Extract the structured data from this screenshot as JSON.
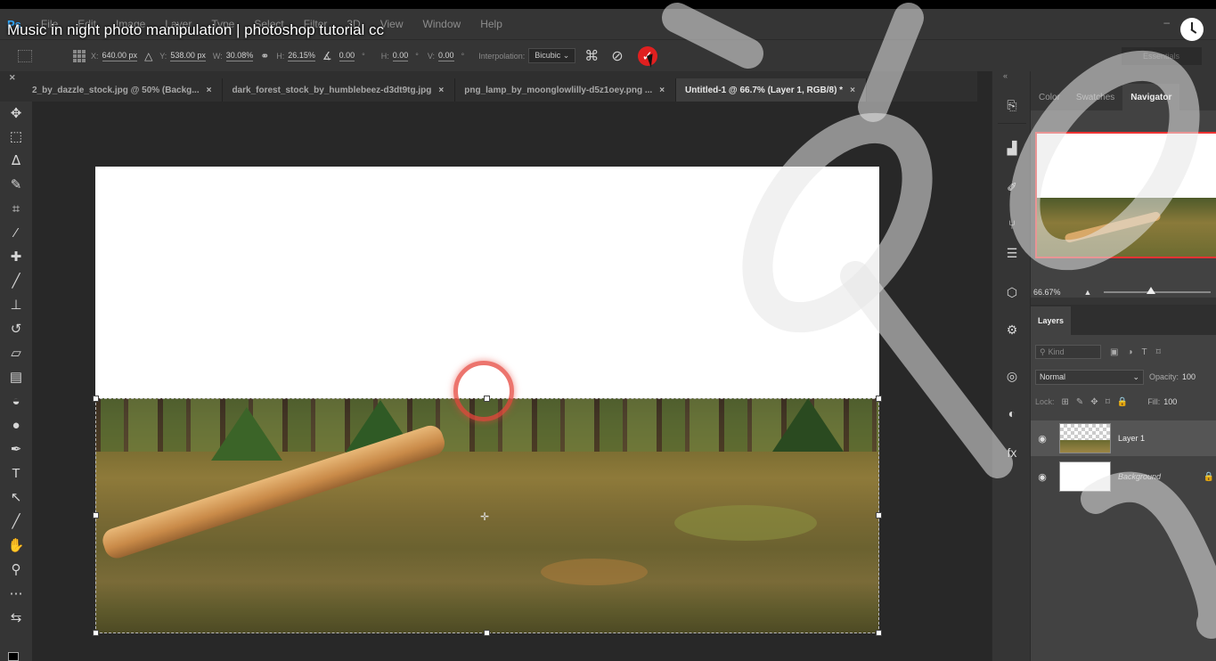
{
  "overlay": {
    "title": "Music in night photo manipulation | photoshop tutorial cc"
  },
  "menubar": {
    "logo": "Ps",
    "items": [
      "File",
      "Edit",
      "Image",
      "Layer",
      "Type",
      "Select",
      "Filter",
      "3D",
      "View",
      "Window",
      "Help"
    ]
  },
  "options": {
    "x_label": "X:",
    "x_value": "640.00 px",
    "y_label": "Y:",
    "y_value": "538.00 px",
    "w_label": "W:",
    "w_value": "30.08%",
    "h_label": "H:",
    "h_value": "26.15%",
    "angle_value": "0.00",
    "deg": "°",
    "hskew_label": "H:",
    "hskew_value": "0.00",
    "vskew_label": "V:",
    "vskew_value": "0.00",
    "interp_label": "Interpolation:",
    "interp_value": "Bicubic",
    "workspace": "Essentials"
  },
  "tabs": [
    {
      "label": "2_by_dazzle_stock.jpg @ 50% (Backg...",
      "close": "×"
    },
    {
      "label": "dark_forest_stock_by_humblebeez-d3dt9tg.jpg",
      "close": "×"
    },
    {
      "label": "png_lamp_by_moonglowlilly-d5z1oey.png ...",
      "close": "×"
    },
    {
      "label": "Untitled-1 @ 66.7% (Layer 1, RGB/8) *",
      "close": "×"
    }
  ],
  "navigator": {
    "tabs": [
      "Color",
      "Swatches",
      "Navigator"
    ],
    "zoom": "66.67%"
  },
  "layers": {
    "tab": "Layers",
    "kind_placeholder": "Kind",
    "blend_mode": "Normal",
    "opacity_label": "Opacity:",
    "opacity_value": "100",
    "lock_label": "Lock:",
    "fill_label": "Fill:",
    "fill_value": "100",
    "rows": [
      {
        "name": "Layer 1"
      },
      {
        "name": "Background"
      }
    ]
  },
  "colors": {
    "accent": "#31a8ff",
    "commit_button": "#e02020",
    "ring": "#e6463c",
    "navigator_frame": "#ee3333"
  },
  "icons": [
    "move-icon",
    "marquee-icon",
    "lasso-icon",
    "quick-select-icon",
    "crop-icon",
    "eyedropper-icon",
    "healing-icon",
    "brush-icon",
    "stamp-icon",
    "history-brush-icon",
    "eraser-icon",
    "gradient-icon",
    "blur-icon",
    "dodge-icon",
    "pen-icon",
    "type-icon",
    "path-select-icon",
    "line-icon",
    "hand-icon",
    "zoom-icon",
    "more-tools-icon"
  ]
}
